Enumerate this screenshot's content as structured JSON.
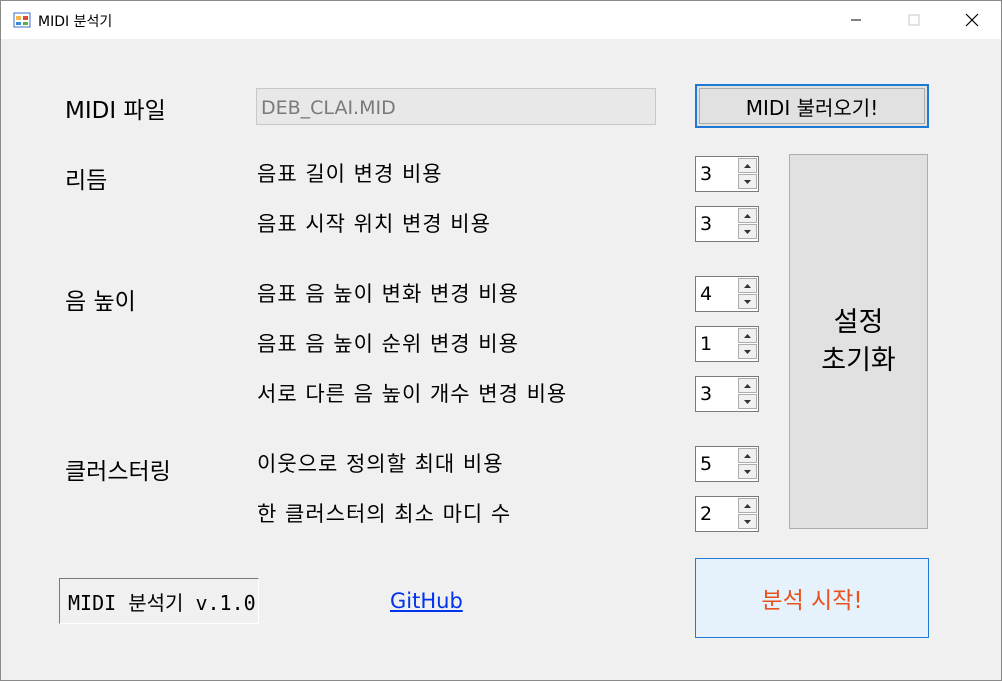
{
  "window": {
    "title": "MIDI 분석기",
    "minimize_icon": "minimize-icon",
    "maximize_icon": "maximize-icon",
    "close_icon": "close-icon"
  },
  "file": {
    "label": "MIDI 파일",
    "value": "DEB_CLAI.MID",
    "load_button": "MIDI 불러오기!"
  },
  "rhythm": {
    "label": "리듬",
    "items": [
      {
        "label": "음표 길이 변경 비용",
        "value": "3"
      },
      {
        "label": "음표 시작 위치 변경 비용",
        "value": "3"
      }
    ]
  },
  "pitch": {
    "label": "음 높이",
    "items": [
      {
        "label": "음표 음 높이 변화 변경 비용",
        "value": "4"
      },
      {
        "label": "음표 음 높이 순위 변경 비용",
        "value": "1"
      },
      {
        "label": "서로 다른 음 높이 개수 변경 비용",
        "value": "3"
      }
    ]
  },
  "clustering": {
    "label": "클러스터링",
    "items": [
      {
        "label": "이웃으로 정의할 최대 비용",
        "value": "5"
      },
      {
        "label": "한 클러스터의 최소 마디 수",
        "value": "2"
      }
    ]
  },
  "buttons": {
    "reset_line1": "설정",
    "reset_line2": "초기화",
    "start": "분석 시작!"
  },
  "footer": {
    "version": "MIDI 분석기 v.1.0",
    "github": "GitHub"
  },
  "colors": {
    "accent": "#1f7ad6",
    "start_text": "#e8521e",
    "link": "#0033ee"
  }
}
